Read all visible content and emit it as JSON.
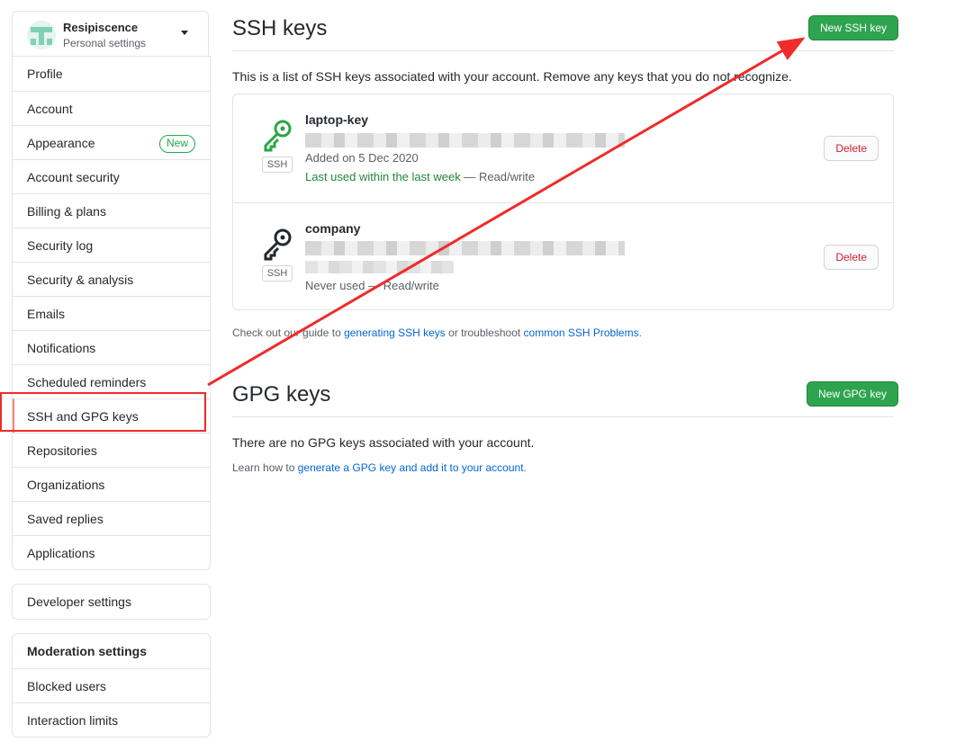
{
  "account": {
    "name": "Resipiscence",
    "subtitle": "Personal settings"
  },
  "sidebar": {
    "items": [
      {
        "label": "Profile"
      },
      {
        "label": "Account"
      },
      {
        "label": "Appearance",
        "badge": "New"
      },
      {
        "label": "Account security"
      },
      {
        "label": "Billing & plans"
      },
      {
        "label": "Security log"
      },
      {
        "label": "Security & analysis"
      },
      {
        "label": "Emails"
      },
      {
        "label": "Notifications"
      },
      {
        "label": "Scheduled reminders"
      },
      {
        "label": "SSH and GPG keys",
        "selected": true
      },
      {
        "label": "Repositories"
      },
      {
        "label": "Organizations"
      },
      {
        "label": "Saved replies"
      },
      {
        "label": "Applications"
      }
    ],
    "developer": {
      "label": "Developer settings"
    },
    "moderation": {
      "heading": "Moderation settings",
      "items": [
        {
          "label": "Blocked users"
        },
        {
          "label": "Interaction limits"
        }
      ]
    }
  },
  "ssh": {
    "title": "SSH keys",
    "new_button": "New SSH key",
    "description": "This is a list of SSH keys associated with your account. Remove any keys that you do not recognize.",
    "keys": [
      {
        "title": "laptop-key",
        "type_label": "SSH",
        "added": "Added on 5 Dec 2020",
        "usage": "Last used within the last week",
        "access": "— Read/write",
        "delete_label": "Delete",
        "status_color": "#28a745"
      },
      {
        "title": "company",
        "type_label": "SSH",
        "added": "",
        "usage": "Never used",
        "access": "— Read/write",
        "delete_label": "Delete",
        "status_color": "#24292e"
      }
    ],
    "help": {
      "prefix": "Check out our guide to ",
      "link1": "generating SSH keys",
      "middle": " or troubleshoot ",
      "link2": "common SSH Problems",
      "suffix": "."
    }
  },
  "gpg": {
    "title": "GPG keys",
    "new_button": "New GPG key",
    "empty_text": "There are no GPG keys associated with your account.",
    "help": {
      "prefix": "Learn how to ",
      "link": "generate a GPG key and add it to your account",
      "suffix": "."
    }
  },
  "colors": {
    "primary_green": "#2ea44f",
    "link_blue": "#0366d6",
    "danger_red": "#cb2431",
    "annotation_red": "#ef2b2b",
    "selected_marker": "#f9826c"
  }
}
